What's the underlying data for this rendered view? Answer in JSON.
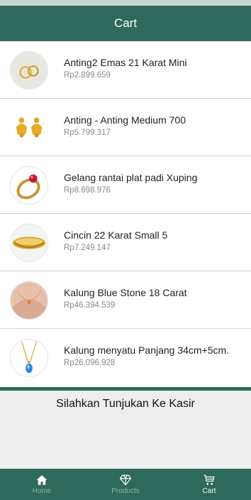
{
  "header": {
    "title": "Cart"
  },
  "cart_items": [
    {
      "name": "Anting2 Emas 21 Karat Mini",
      "price": "Rp2.899.659",
      "image": "earring-gold-mini"
    },
    {
      "name": "Anting - Anting Medium 700",
      "price": "Rp5.799.317",
      "image": "earring-gold-medium"
    },
    {
      "name": "Gelang rantai plat padi Xuping",
      "price": "Rp8.698.976",
      "image": "ring-red-stone"
    },
    {
      "name": "Cincin 22 Karat Small 5",
      "price": "Rp7.249.147",
      "image": "gold-band"
    },
    {
      "name": "Kalung Blue Stone 18 Carat",
      "price": "Rp46.394.539",
      "image": "necklace-on-neck"
    },
    {
      "name": "Kalung menyatu Panjang 34cm+5cm.",
      "price": "Rp26.096.928",
      "image": "necklace-blue-pendant"
    }
  ],
  "footer": {
    "message": "Silahkan Tunjukan Ke Kasir"
  },
  "tabs": [
    {
      "label": "Home",
      "icon": "home-icon",
      "active": false
    },
    {
      "label": "Products",
      "icon": "diamond-icon",
      "active": false
    },
    {
      "label": "Cart",
      "icon": "cart-icon",
      "active": true
    }
  ],
  "colors": {
    "primary": "#2d6a5c",
    "inactive_tab": "#8fb3a9",
    "price": "#8a8a8a"
  }
}
